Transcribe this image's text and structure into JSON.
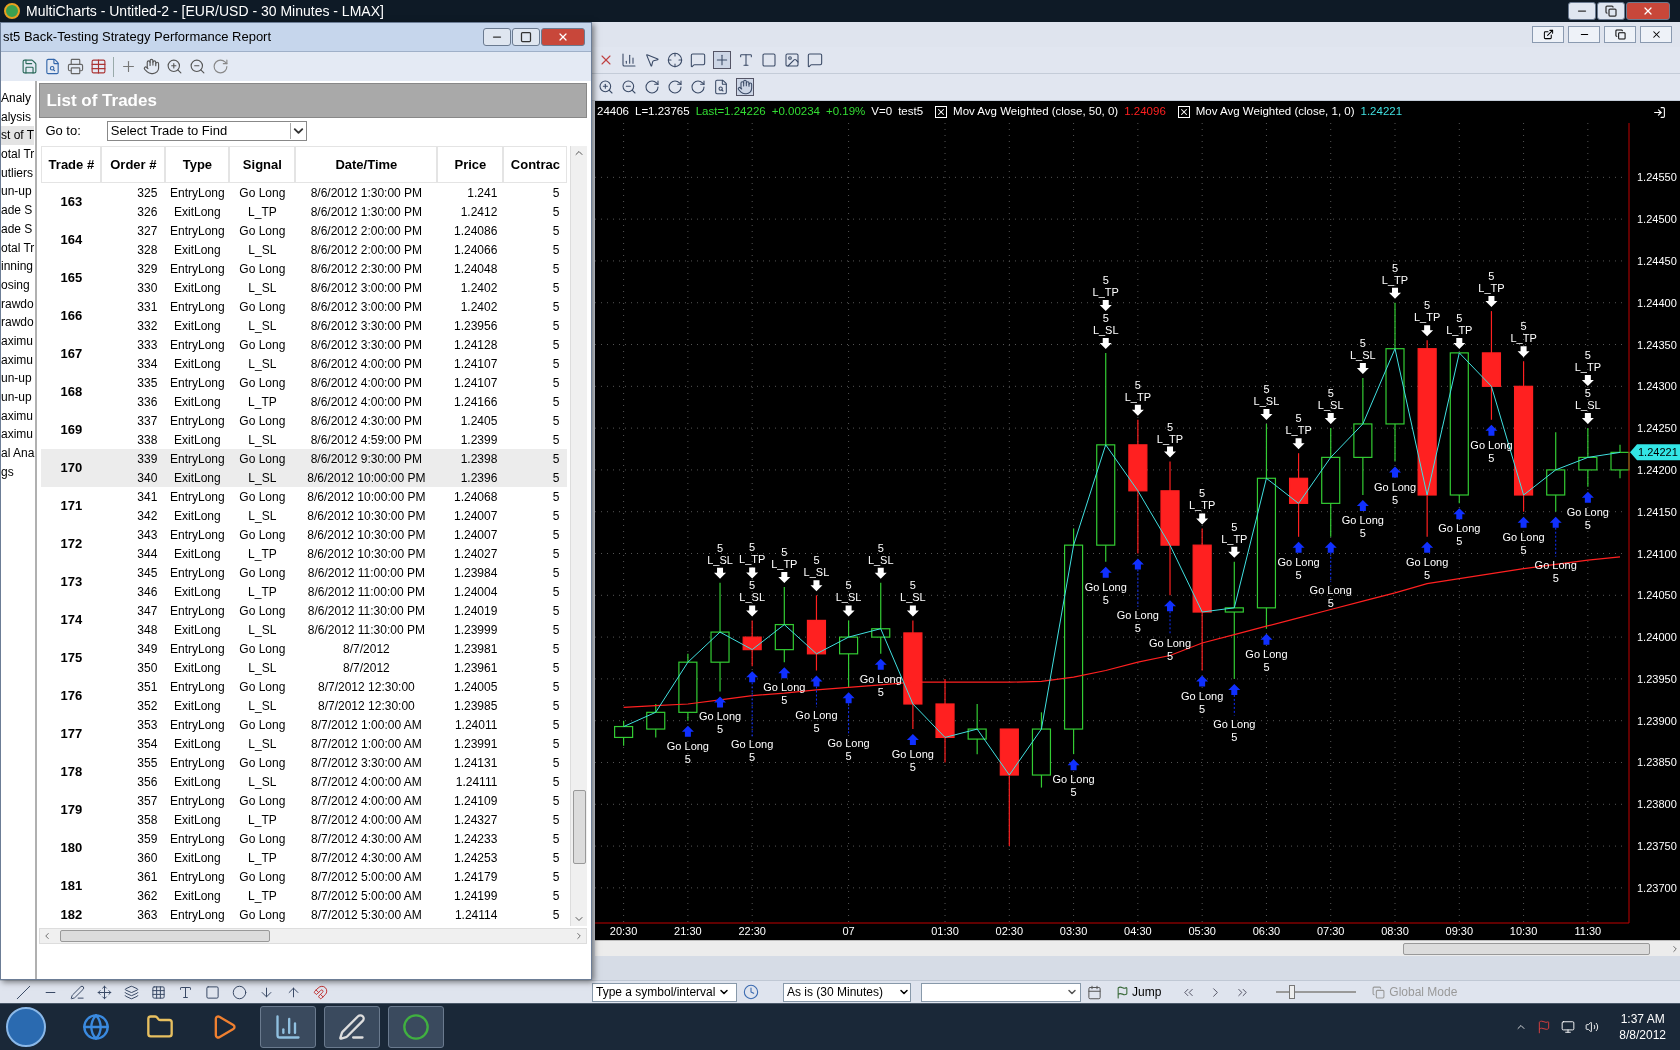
{
  "app_title": "MultiCharts - Untitled-2 - [EUR/USD - 30 Minutes - LMAX]",
  "report": {
    "title": "st5 Back-Testing Strategy Performance Report",
    "nav_items": [
      {
        "label": "Analy",
        "selected": false
      },
      {
        "label": "alysis",
        "selected": false
      },
      {
        "label": "st of T",
        "selected": true
      },
      {
        "label": "otal Tr",
        "selected": false
      },
      {
        "label": "utliers",
        "selected": false
      },
      {
        "label": "un-up",
        "selected": false
      },
      {
        "label": "ade S",
        "selected": false
      },
      {
        "label": "ade S",
        "selected": false
      },
      {
        "label": "otal Tr",
        "selected": false
      },
      {
        "label": "inning",
        "selected": false
      },
      {
        "label": "osing",
        "selected": false
      },
      {
        "label": "rawdo",
        "selected": false
      },
      {
        "label": "rawdo",
        "selected": false
      },
      {
        "label": "aximu",
        "selected": false
      },
      {
        "label": "aximu",
        "selected": false
      },
      {
        "label": "un-up",
        "selected": false
      },
      {
        "label": "un-up",
        "selected": false
      },
      {
        "label": "aximu",
        "selected": false
      },
      {
        "label": "aximu",
        "selected": false
      },
      {
        "label": "al Ana",
        "selected": false
      },
      {
        "label": "gs",
        "selected": false
      }
    ],
    "section_title": "List of Trades",
    "goto_label": "Go to:",
    "goto_value": "Select Trade to Find",
    "columns": [
      "Trade #",
      "Order #",
      "Type",
      "Signal",
      "Date/Time",
      "Price",
      "Contrac"
    ],
    "trades": [
      {
        "trade": "163",
        "selected": false,
        "orders": [
          [
            "325",
            "EntryLong",
            "Go Long",
            "8/6/2012 1:30:00 PM",
            "1.241",
            "5"
          ],
          [
            "326",
            "ExitLong",
            "L_TP",
            "8/6/2012 1:30:00 PM",
            "1.2412",
            "5"
          ]
        ]
      },
      {
        "trade": "164",
        "selected": false,
        "orders": [
          [
            "327",
            "EntryLong",
            "Go Long",
            "8/6/2012 2:00:00 PM",
            "1.24086",
            "5"
          ],
          [
            "328",
            "ExitLong",
            "L_SL",
            "8/6/2012 2:00:00 PM",
            "1.24066",
            "5"
          ]
        ]
      },
      {
        "trade": "165",
        "selected": false,
        "orders": [
          [
            "329",
            "EntryLong",
            "Go Long",
            "8/6/2012 2:30:00 PM",
            "1.24048",
            "5"
          ],
          [
            "330",
            "ExitLong",
            "L_SL",
            "8/6/2012 3:00:00 PM",
            "1.2402",
            "5"
          ]
        ]
      },
      {
        "trade": "166",
        "selected": false,
        "orders": [
          [
            "331",
            "EntryLong",
            "Go Long",
            "8/6/2012 3:00:00 PM",
            "1.2402",
            "5"
          ],
          [
            "332",
            "ExitLong",
            "L_SL",
            "8/6/2012 3:30:00 PM",
            "1.23956",
            "5"
          ]
        ]
      },
      {
        "trade": "167",
        "selected": false,
        "orders": [
          [
            "333",
            "EntryLong",
            "Go Long",
            "8/6/2012 3:30:00 PM",
            "1.24128",
            "5"
          ],
          [
            "334",
            "ExitLong",
            "L_SL",
            "8/6/2012 4:00:00 PM",
            "1.24107",
            "5"
          ]
        ]
      },
      {
        "trade": "168",
        "selected": false,
        "orders": [
          [
            "335",
            "EntryLong",
            "Go Long",
            "8/6/2012 4:00:00 PM",
            "1.24107",
            "5"
          ],
          [
            "336",
            "ExitLong",
            "L_TP",
            "8/6/2012 4:00:00 PM",
            "1.24166",
            "5"
          ]
        ]
      },
      {
        "trade": "169",
        "selected": false,
        "orders": [
          [
            "337",
            "EntryLong",
            "Go Long",
            "8/6/2012 4:30:00 PM",
            "1.2405",
            "5"
          ],
          [
            "338",
            "ExitLong",
            "L_SL",
            "8/6/2012 4:59:00 PM",
            "1.2399",
            "5"
          ]
        ]
      },
      {
        "trade": "170",
        "selected": true,
        "orders": [
          [
            "339",
            "EntryLong",
            "Go Long",
            "8/6/2012 9:30:00 PM",
            "1.2398",
            "5"
          ],
          [
            "340",
            "ExitLong",
            "L_SL",
            "8/6/2012 10:00:00 PM",
            "1.2396",
            "5"
          ]
        ]
      },
      {
        "trade": "171",
        "selected": false,
        "orders": [
          [
            "341",
            "EntryLong",
            "Go Long",
            "8/6/2012 10:00:00 PM",
            "1.24068",
            "5"
          ],
          [
            "342",
            "ExitLong",
            "L_SL",
            "8/6/2012 10:30:00 PM",
            "1.24007",
            "5"
          ]
        ]
      },
      {
        "trade": "172",
        "selected": false,
        "orders": [
          [
            "343",
            "EntryLong",
            "Go Long",
            "8/6/2012 10:30:00 PM",
            "1.24007",
            "5"
          ],
          [
            "344",
            "ExitLong",
            "L_TP",
            "8/6/2012 10:30:00 PM",
            "1.24027",
            "5"
          ]
        ]
      },
      {
        "trade": "173",
        "selected": false,
        "orders": [
          [
            "345",
            "EntryLong",
            "Go Long",
            "8/6/2012 11:00:00 PM",
            "1.23984",
            "5"
          ],
          [
            "346",
            "ExitLong",
            "L_TP",
            "8/6/2012 11:00:00 PM",
            "1.24004",
            "5"
          ]
        ]
      },
      {
        "trade": "174",
        "selected": false,
        "orders": [
          [
            "347",
            "EntryLong",
            "Go Long",
            "8/6/2012 11:30:00 PM",
            "1.24019",
            "5"
          ],
          [
            "348",
            "ExitLong",
            "L_SL",
            "8/6/2012 11:30:00 PM",
            "1.23999",
            "5"
          ]
        ]
      },
      {
        "trade": "175",
        "selected": false,
        "orders": [
          [
            "349",
            "EntryLong",
            "Go Long",
            "8/7/2012",
            "1.23981",
            "5"
          ],
          [
            "350",
            "ExitLong",
            "L_SL",
            "8/7/2012",
            "1.23961",
            "5"
          ]
        ]
      },
      {
        "trade": "176",
        "selected": false,
        "orders": [
          [
            "351",
            "EntryLong",
            "Go Long",
            "8/7/2012 12:30:00",
            "1.24005",
            "5"
          ],
          [
            "352",
            "ExitLong",
            "L_SL",
            "8/7/2012 12:30:00",
            "1.23985",
            "5"
          ]
        ]
      },
      {
        "trade": "177",
        "selected": false,
        "orders": [
          [
            "353",
            "EntryLong",
            "Go Long",
            "8/7/2012 1:00:00 AM",
            "1.24011",
            "5"
          ],
          [
            "354",
            "ExitLong",
            "L_SL",
            "8/7/2012 1:00:00 AM",
            "1.23991",
            "5"
          ]
        ]
      },
      {
        "trade": "178",
        "selected": false,
        "orders": [
          [
            "355",
            "EntryLong",
            "Go Long",
            "8/7/2012 3:30:00 AM",
            "1.24131",
            "5"
          ],
          [
            "356",
            "ExitLong",
            "L_SL",
            "8/7/2012 4:00:00 AM",
            "1.24111",
            "5"
          ]
        ]
      },
      {
        "trade": "179",
        "selected": false,
        "orders": [
          [
            "357",
            "EntryLong",
            "Go Long",
            "8/7/2012 4:00:00 AM",
            "1.24109",
            "5"
          ],
          [
            "358",
            "ExitLong",
            "L_TP",
            "8/7/2012 4:00:00 AM",
            "1.24327",
            "5"
          ]
        ]
      },
      {
        "trade": "180",
        "selected": false,
        "orders": [
          [
            "359",
            "EntryLong",
            "Go Long",
            "8/7/2012 4:30:00 AM",
            "1.24233",
            "5"
          ],
          [
            "360",
            "ExitLong",
            "L_TP",
            "8/7/2012 4:30:00 AM",
            "1.24253",
            "5"
          ]
        ]
      },
      {
        "trade": "181",
        "selected": false,
        "orders": [
          [
            "361",
            "EntryLong",
            "Go Long",
            "8/7/2012 5:00:00 AM",
            "1.24179",
            "5"
          ],
          [
            "362",
            "ExitLong",
            "L_TP",
            "8/7/2012 5:00:00 AM",
            "1.24199",
            "5"
          ]
        ]
      },
      {
        "trade": "182",
        "selected": false,
        "orders": [
          [
            "363",
            "EntryLong",
            "Go Long",
            "8/7/2012 5:30:00 AM",
            "1.24114",
            "5"
          ]
        ]
      }
    ]
  },
  "chart": {
    "status": [
      {
        "text": "24406",
        "color": "#ffffff"
      },
      {
        "text": "L=1.23765",
        "color": "#ffffff"
      },
      {
        "text": "Last=1.24226",
        "color": "#33dd33"
      },
      {
        "text": "+0.00234",
        "color": "#33dd33"
      },
      {
        "text": "+0.19%",
        "color": "#33dd33"
      },
      {
        "text": "V=0",
        "color": "#ffffff"
      },
      {
        "text": "test5",
        "color": "#ffffff"
      }
    ],
    "studies": [
      {
        "value": "1.24096",
        "color": "#ff2020",
        "checked": true
      },
      {
        "value": "1.24221",
        "color": "#40e0e0",
        "checked": true
      }
    ],
    "last_price": "1.24221",
    "chart_data": {
      "type": "line",
      "grid": true,
      "categories": [
        "20:30",
        null,
        "21:30",
        null,
        "22:30",
        null,
        null,
        "07",
        null,
        null,
        "01:30",
        null,
        "02:30",
        null,
        "03:30",
        null,
        "04:30",
        null,
        "05:30",
        null,
        "06:30",
        null,
        "07:30",
        null,
        "08:30",
        null,
        "09:30",
        null,
        "10:30",
        null,
        "11:30",
        null
      ],
      "ylim": [
        1.23658,
        1.24615
      ],
      "yticks": [
        {
          "value": 1.2455,
          "label": "1.24550"
        },
        {
          "value": 1.245,
          "label": "1.24500"
        },
        {
          "value": 1.2445,
          "label": "1.24450"
        },
        {
          "value": 1.244,
          "label": "1.24400"
        },
        {
          "value": 1.2435,
          "label": "1.24350"
        },
        {
          "value": 1.243,
          "label": "1.24300"
        },
        {
          "value": 1.2425,
          "label": "1.24250"
        },
        {
          "value": 1.242,
          "label": "1.24200"
        },
        {
          "value": 1.2415,
          "label": "1.24150"
        },
        {
          "value": 1.241,
          "label": "1.24100"
        },
        {
          "value": 1.2405,
          "label": "1.24050"
        },
        {
          "value": 1.24,
          "label": "1.24000"
        },
        {
          "value": 1.2395,
          "label": "1.23950"
        },
        {
          "value": 1.239,
          "label": "1.23900"
        },
        {
          "value": 1.2385,
          "label": "1.23850"
        },
        {
          "value": 1.238,
          "label": "1.23800"
        },
        {
          "value": 1.2375,
          "label": "1.23750"
        },
        {
          "value": 1.237,
          "label": "1.23700"
        }
      ],
      "series": [
        {
          "name": "Mov Avg Weighted (close, 50, 0)",
          "color": "#ff2020",
          "values": [
            1.23916,
            1.23918,
            1.2392,
            1.23925,
            1.2393,
            1.23933,
            1.23937,
            1.2394,
            1.23943,
            1.23946,
            1.23946,
            1.23946,
            1.23946,
            1.23947,
            1.23952,
            1.2396,
            1.2397,
            1.23978,
            1.23993,
            1.24003,
            1.24013,
            1.24023,
            1.24033,
            1.24043,
            1.24053,
            1.24064,
            1.2407,
            1.24076,
            1.24082,
            1.24087,
            1.24092,
            1.24096
          ]
        },
        {
          "name": "Mov Avg Weighted (close, 1, 0)",
          "color": "#40e0e0",
          "values": [
            1.23893,
            1.2391,
            1.2397,
            1.24006,
            1.23985,
            1.24015,
            1.2398,
            1.24,
            1.2401,
            1.2392,
            1.2388,
            1.2389,
            1.23835,
            1.2389,
            1.2411,
            1.2423,
            1.24175,
            1.2411,
            1.2403,
            1.24035,
            1.2419,
            1.2416,
            1.24215,
            1.24255,
            1.24345,
            1.2417,
            1.2434,
            1.243,
            1.2417,
            1.242,
            1.24215,
            1.24221
          ]
        }
      ],
      "annotations": [
        "Go Long\n5",
        "5\nL_SL",
        "Go Long\n5",
        "5\nL_TP",
        "5\nL_SL",
        "Go Long\n5",
        "5\nL_TP",
        "Go Long\n5",
        "5\nL_SL",
        "Go Long\n5",
        "5\nL_SL",
        "Go Long\n5",
        "5\nL_SL",
        "Go Long\n5",
        "5\nL_SL",
        "Go Long\n5",
        "Go Long\n5",
        "5\nL_TP",
        "5\nL_SL",
        "Go Long\n5",
        "5\nL_TP",
        "Go Long\n5",
        "5\nL_TP",
        "Go Long\n5",
        "5\nL_TP",
        "Go Long\n5",
        "5\nL_TP",
        "Go Long\n5",
        "5\nL_SL",
        "Go Long\n5",
        "5\nL_TP",
        "Go Long\n5",
        "5\nL_SL",
        "Go Long\n5",
        "5\nL_SL",
        "Go Long\n5",
        "5\nL_TP",
        "Go Long\n5",
        "5\nL_TP",
        "Go Long\n5",
        "5\nL_TP",
        "Go Long\n5",
        "5\nL_TP",
        "Go Long\n5",
        "5\nL_TP",
        "Go Long\n5",
        "Go Long\n5",
        "5\nL_TP",
        "5\nL_SL",
        "Go Long\n5"
      ]
    }
  },
  "bottom_toolbar": {
    "symbol_placeholder": "Type a symbol/interval",
    "resolution": "As is (30 Minutes)",
    "jump": "Jump",
    "slider": {
      "level": 0.2
    },
    "global_mode": {
      "label": "Global Mode",
      "disabled": true
    }
  },
  "taskbar": {
    "time": "1:37 AM",
    "date": "8/8/2012"
  }
}
